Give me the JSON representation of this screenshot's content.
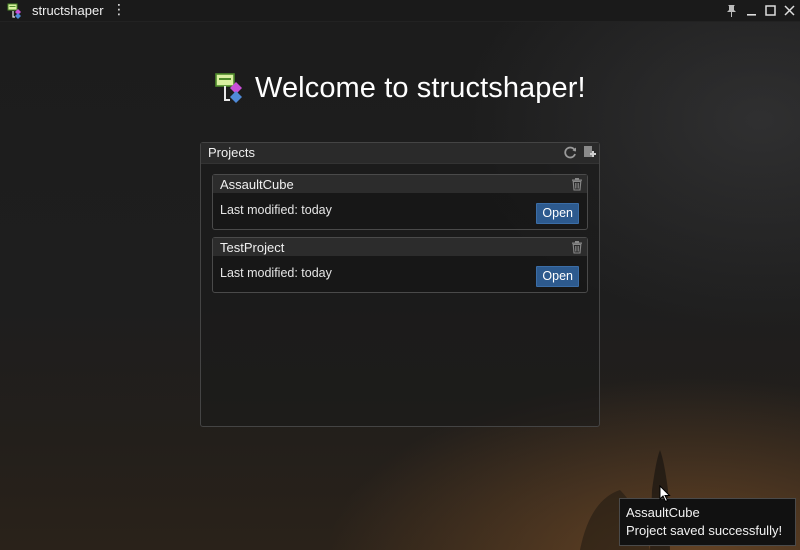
{
  "window": {
    "title": "structshaper",
    "controls": [
      "pin-icon",
      "minimize-icon",
      "maximize-icon",
      "close-icon"
    ]
  },
  "welcome": {
    "text": "Welcome to structshaper!"
  },
  "projects_panel": {
    "title": "Projects",
    "actions": [
      "refresh-icon",
      "new-project-icon"
    ],
    "projects": [
      {
        "name": "AssaultCube",
        "modified": "Last modified: today",
        "open_label": "Open"
      },
      {
        "name": "TestProject",
        "modified": "Last modified: today",
        "open_label": "Open"
      }
    ]
  },
  "toast": {
    "title": "AssaultCube",
    "message": "Project saved successfully!"
  },
  "colors": {
    "accent": "#2d5a8e",
    "titlebar": "#1a1a1a",
    "panel_border": "#444444"
  }
}
